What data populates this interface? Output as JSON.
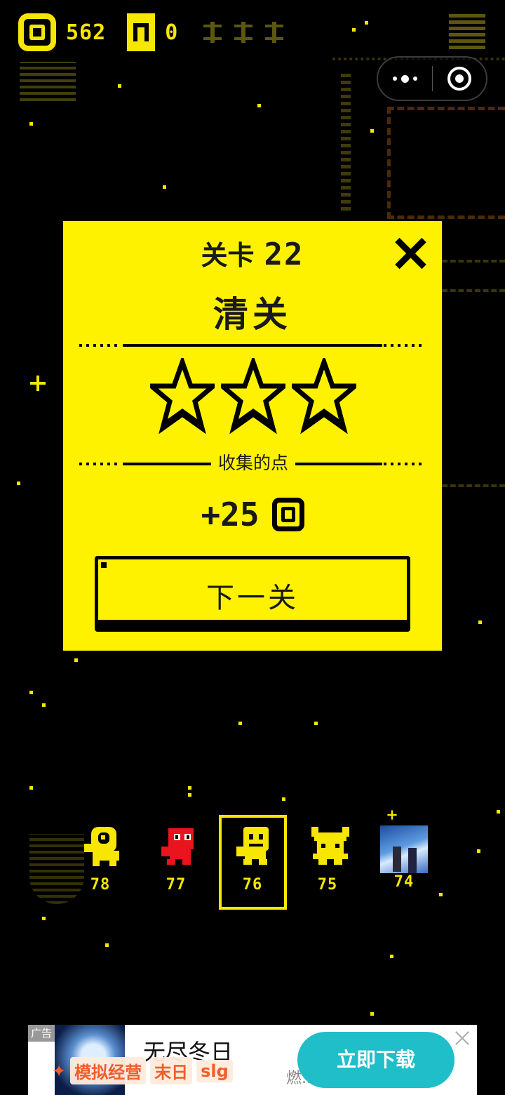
{
  "hud": {
    "coins": "562",
    "gates": "0",
    "coin_icon": "coin-icon",
    "gate_icon": "gate-icon"
  },
  "capsule": {
    "more_icon": "more-dots-icon",
    "close_icon": "target-close-icon"
  },
  "dialog": {
    "level_label": "关卡",
    "level_number": "22",
    "status": "清关",
    "stars_earned": 3,
    "stars_total": 3,
    "collected_label": "收集的点",
    "reward": "+25",
    "next_button": "下一关",
    "close_icon": "close-icon"
  },
  "characters": [
    {
      "name": "one-eyed-yellow",
      "level": "78",
      "color": "#f7e600"
    },
    {
      "name": "red-runner",
      "level": "77",
      "color": "#e8141e"
    },
    {
      "name": "yellow-masked",
      "level": "76",
      "color": "#f7e600",
      "selected": true
    },
    {
      "name": "viking-yellow",
      "level": "75",
      "color": "#f7e600"
    },
    {
      "name": "photo-avatar",
      "level": "74",
      "color": "#f7e600"
    }
  ],
  "ad": {
    "tag": "广告",
    "title": "无尽冬日",
    "subtitle": "燃...",
    "chips": [
      "模拟经营",
      "末日",
      "slg"
    ],
    "cta": "立即下载"
  },
  "colors": {
    "accent": "#f7e600",
    "panel": "#fff200",
    "background": "#000000",
    "cta": "#1fbec8"
  }
}
